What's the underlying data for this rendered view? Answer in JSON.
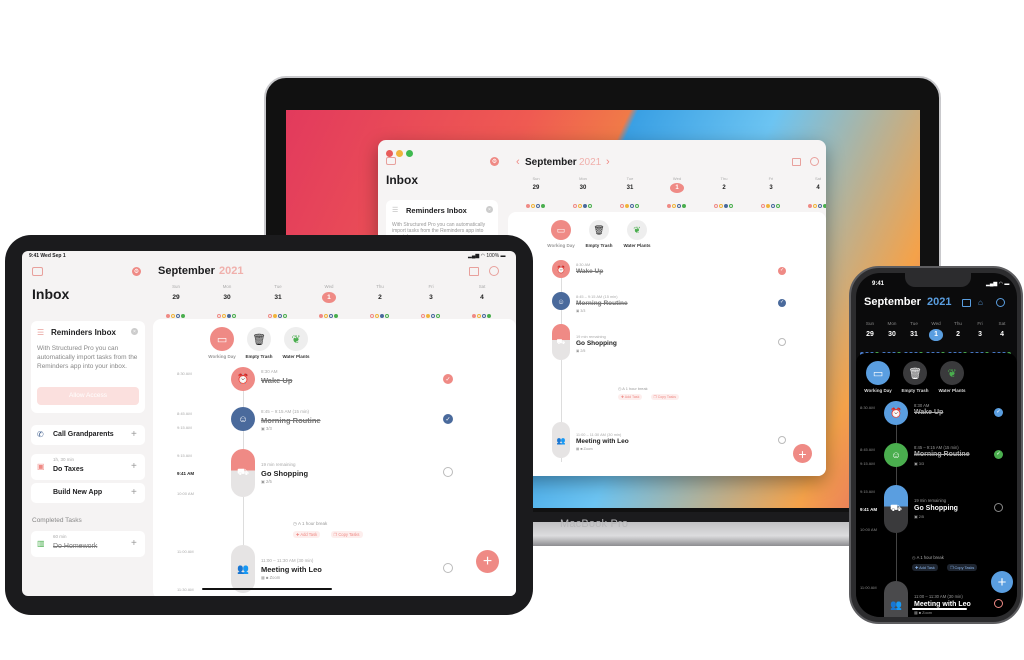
{
  "colors": {
    "accent": "#ef8a85",
    "blue": "#4a6a9c",
    "dark_blue": "#5a9ee0",
    "dark_green": "#4aae4e",
    "gray": "#e6e4e4"
  },
  "status_bar": {
    "time": "9:41",
    "date": "Wed Sep 1",
    "battery": "100%"
  },
  "calendar": {
    "month": "September",
    "year": "2021",
    "days": [
      {
        "weekday": "Sun",
        "day": "29"
      },
      {
        "weekday": "Mon",
        "day": "30"
      },
      {
        "weekday": "Tue",
        "day": "31"
      },
      {
        "weekday": "Wed",
        "day": "1",
        "selected": true
      },
      {
        "weekday": "Thu",
        "day": "2"
      },
      {
        "weekday": "Fri",
        "day": "3"
      },
      {
        "weekday": "Sat",
        "day": "4"
      }
    ]
  },
  "quick_actions": [
    {
      "label": "Working Day",
      "icon": "monitor-icon"
    },
    {
      "label": "Empty Trash",
      "icon": "trash-icon"
    },
    {
      "label": "Water Plants",
      "icon": "leaf-icon"
    }
  ],
  "inbox": {
    "title": "Inbox",
    "reminders_card": {
      "title": "Reminders Inbox",
      "body": "With Structured Pro you can automatically import tasks from the Reminders app into your inbox.",
      "button": "Allow Access"
    },
    "items": [
      {
        "title": "Call Grandparents",
        "meta": "",
        "icon": "phone-icon"
      },
      {
        "title": "Do Taxes",
        "meta": "1h, 30 min",
        "icon": "bag-icon"
      },
      {
        "title": "Build New App",
        "meta": "",
        "icon": "code-icon"
      }
    ],
    "completed_header": "Completed Tasks",
    "completed": [
      {
        "title": "Do Homework",
        "meta": "60 min",
        "icon": "book-icon"
      }
    ]
  },
  "timeline": {
    "tasks": [
      {
        "start_label": "8:30 AM",
        "time": "8:30 AM",
        "title": "Wake Up",
        "done": true,
        "icon": "alarm-icon"
      },
      {
        "start_label": "8:45 AM",
        "end_label": "9:15 AM",
        "time": "8:45 – 9:15 AM (15 min)",
        "title": "Morning Routine",
        "subtasks": "3/3",
        "done": true,
        "icon": "smiley-icon"
      },
      {
        "start_label": "9:15 AM",
        "now_label": "9:41 AM",
        "end_label": "10:00 AM",
        "time": "19 min remaining",
        "title": "Go Shopping",
        "subtasks": "2/5",
        "done": false,
        "icon": "cart-icon"
      },
      {
        "start_label": "11:00 AM",
        "end_label": "11:30 AM",
        "time": "11:00 – 11:30 AM (30 min)",
        "title": "Meeting with Leo",
        "location": "Zoom",
        "done": false,
        "icon": "people-icon"
      }
    ],
    "break_text": "A 1 hour break",
    "add_task": "Add Task",
    "copy_tasks": "Copy Tasks"
  },
  "device_label": "MacBook Pro"
}
